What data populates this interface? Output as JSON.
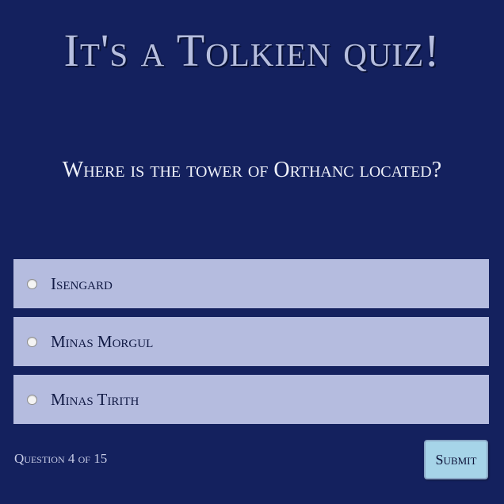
{
  "quiz": {
    "title": "It's a Tolkien quiz!",
    "question": "Where is the tower of Orthanc located?",
    "answers": [
      {
        "label": "Isengard",
        "selected": false
      },
      {
        "label": "Minas Morgul",
        "selected": false
      },
      {
        "label": "Minas Tirith",
        "selected": false
      }
    ],
    "progress": "Question 4 of 15",
    "submit_label": "Submit"
  },
  "colors": {
    "background": "#14215e",
    "title": "#b6bedf",
    "answer_bg": "#b5bcdf",
    "submit_bg": "#a6d4e8"
  }
}
